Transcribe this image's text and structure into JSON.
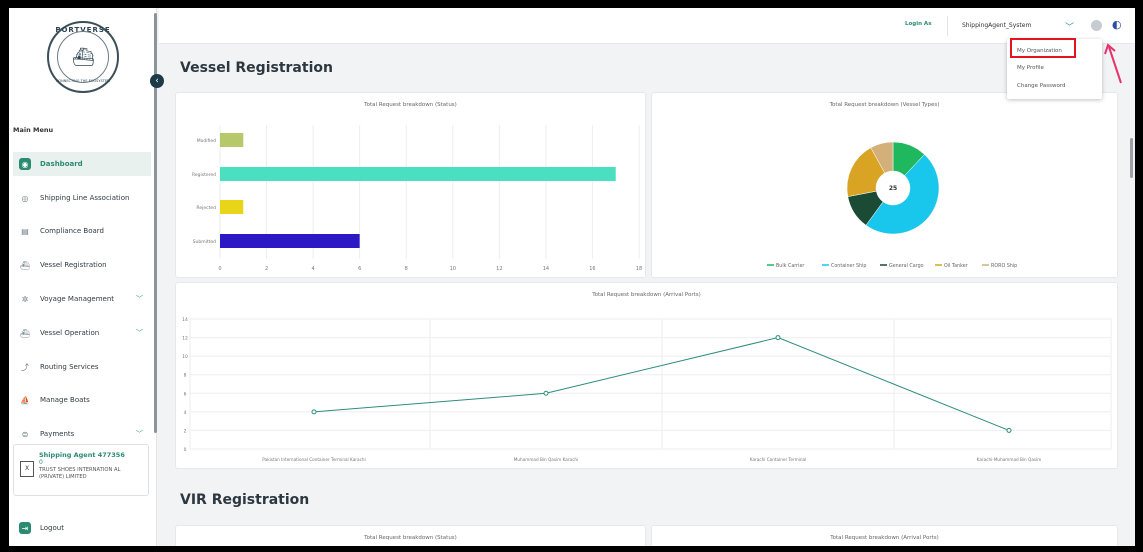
{
  "sidebar": {
    "logo_name": "PORTVERSE",
    "logo_tagline": "CONNECTING THE ECOSYSTEM",
    "menu_title": "Main Menu",
    "items": [
      {
        "label": "Dashboard",
        "icon": "dashboard-icon"
      },
      {
        "label": "Shipping Line Association",
        "icon": "globe-icon"
      },
      {
        "label": "Compliance Board",
        "icon": "document-icon"
      },
      {
        "label": "Vessel Registration",
        "icon": "ship-icon"
      },
      {
        "label": "Voyage Management",
        "icon": "compass-icon"
      },
      {
        "label": "Vessel Operation",
        "icon": "ship-operation-icon"
      },
      {
        "label": "Routing Services",
        "icon": "route-icon"
      },
      {
        "label": "Manage Boats",
        "icon": "boat-icon"
      },
      {
        "label": "Payments",
        "icon": "payment-icon"
      }
    ],
    "agent": {
      "name": "Shipping Agent 477356",
      "count": "0",
      "org": "TRUST SHOES INTERNATION AL (PRIVATE) LIMITED",
      "badge": "X"
    },
    "logout_label": "Logout"
  },
  "topbar": {
    "login_as_label": "Login As",
    "user_value": "ShippingAgent_System"
  },
  "dropdown": {
    "items": [
      "My Organization",
      "My Profile",
      "Change Password"
    ],
    "highlight_color": "#e2141e"
  },
  "main": {
    "title": "Vessel Registration",
    "section2_title": "VIR Registration",
    "vir_cards": [
      "Total Request breakdown (Status)",
      "Total Request breakdown (Arrival Ports)"
    ]
  },
  "chart_data": [
    {
      "type": "bar",
      "title": "Total Request breakdown (Status)",
      "orientation": "horizontal",
      "categories": [
        "Modified",
        "Registered",
        "Rejected",
        "Submitted"
      ],
      "values": [
        1,
        17,
        1,
        6
      ],
      "colors": [
        "#b6c96a",
        "#49dfc0",
        "#e8d418",
        "#2c19c4"
      ],
      "xlim": [
        0,
        18
      ],
      "xticks": [
        "0",
        "2",
        "4",
        "6",
        "8",
        "10",
        "12",
        "14",
        "16",
        "18"
      ]
    },
    {
      "type": "pie",
      "title": "Total Request breakdown (Vessel Types)",
      "center_label": "25",
      "categories": [
        "Bulk Carrier",
        "Container Ship",
        "General Cargo",
        "Oil Tanker",
        "RORO Ship"
      ],
      "values": [
        3,
        12,
        3,
        5,
        2
      ],
      "colors": [
        "#1fb85f",
        "#19c7ec",
        "#1b4a35",
        "#d9a424",
        "#d3b07a"
      ]
    },
    {
      "type": "line",
      "title": "Total Request breakdown (Arrival Ports)",
      "categories": [
        "Pakistan International Container Terminal Karachi",
        "Muhammad Bin Qasim Karachi",
        "Karachi Container Terminal",
        "Karachi-Muhammad Bin Qasim"
      ],
      "values": [
        4,
        6,
        12,
        2
      ],
      "color": "#2e8c7e",
      "ylim": [
        0,
        14
      ],
      "yticks": [
        "0",
        "2",
        "4",
        "6",
        "8",
        "10",
        "12",
        "14"
      ]
    }
  ]
}
